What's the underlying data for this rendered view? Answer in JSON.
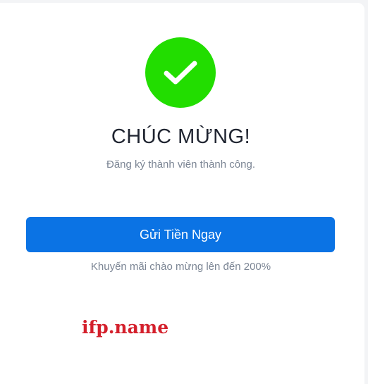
{
  "dialog": {
    "icon": "checkmark-icon",
    "title": "CHÚC MỪNG!",
    "subtitle": "Đăng ký thành viên thành công.",
    "deposit_button_label": "Gửi Tiền Ngay",
    "promo_text": "Khuyến mãi chào mừng lên đến 200%"
  },
  "watermark": {
    "text": "ifp.name"
  },
  "colors": {
    "success": "#22dd00",
    "primary": "#0b73e4",
    "watermark": "#d4202c"
  }
}
